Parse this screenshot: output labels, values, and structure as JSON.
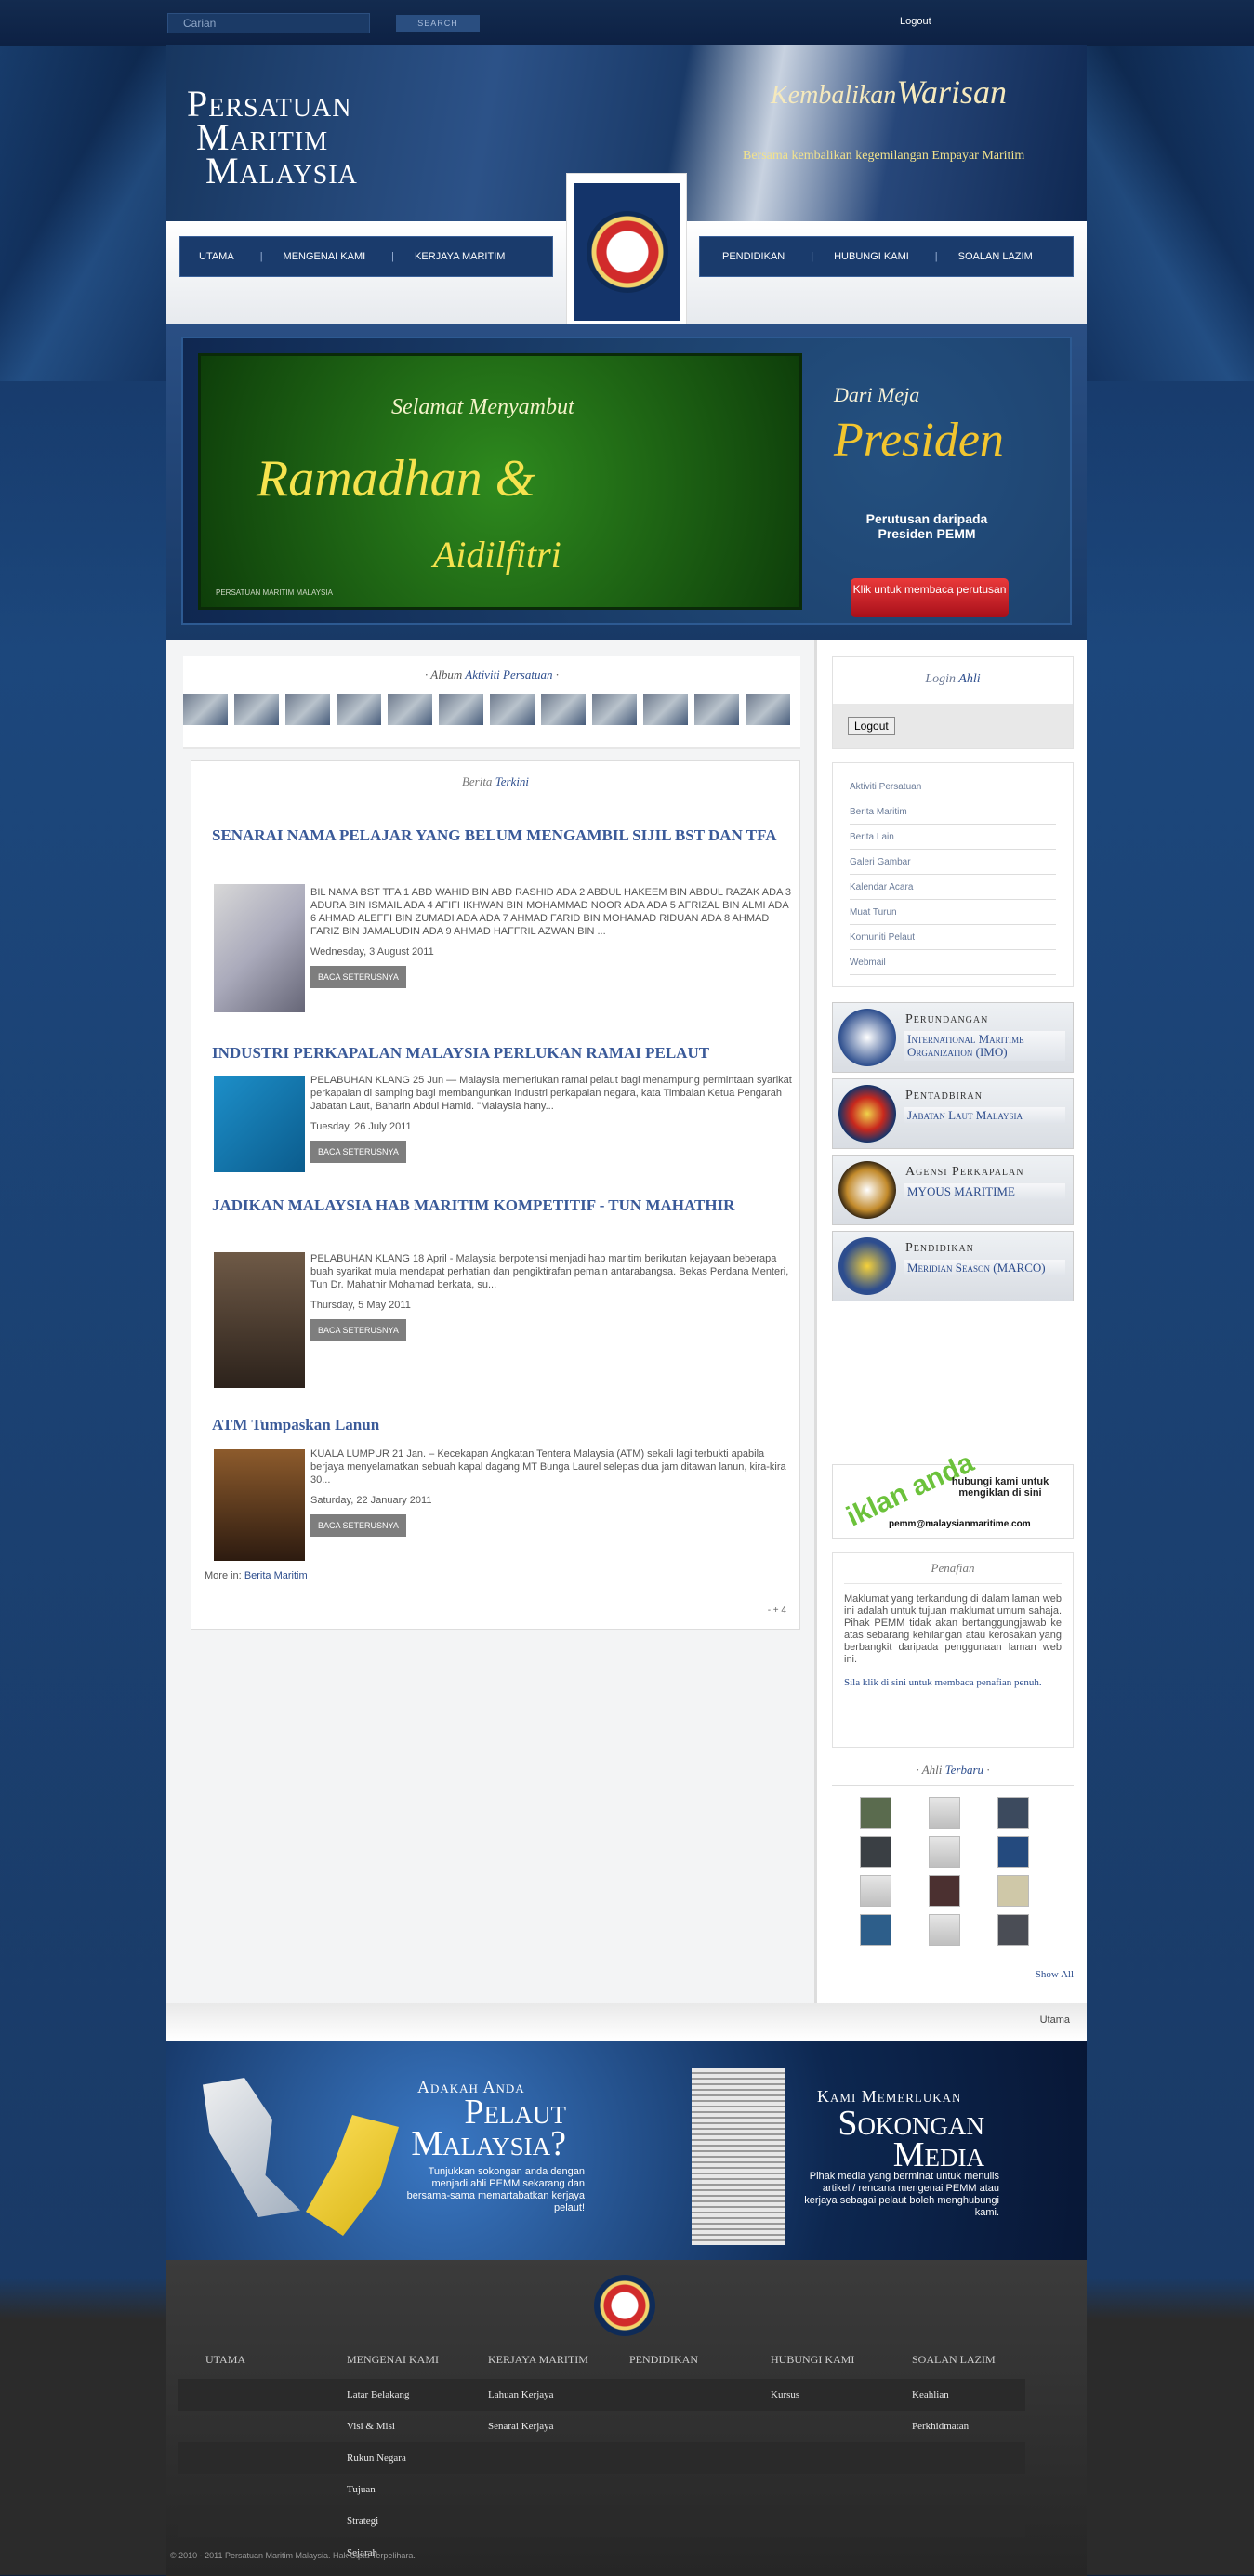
{
  "topbar": {
    "search_placeholder": "Carian",
    "search_button": "SEARCH",
    "logout": "Logout"
  },
  "header": {
    "title_lines": [
      "Persatuan",
      "Maritim",
      "Malaysia"
    ],
    "slogan_a": "Kembalikan",
    "slogan_b": "Warisan",
    "subslogan": "Bersama kembalikan kegemilangan Empayar Maritim"
  },
  "nav": {
    "left": [
      "UTAMA",
      "MENGENAI KAMI",
      "KERJAYA MARITIM"
    ],
    "right": [
      "PENDIDIKAN",
      "HUBUNGI KAMI",
      "SOALAN LAZIM"
    ]
  },
  "banner": {
    "selamat": "Selamat Menyambut",
    "ramadhan": "Ramadhan &",
    "aidil": "Aidilfitri",
    "org": "PERSATUAN MARITIM MALAYSIA",
    "dari": "Dari Meja",
    "presiden": "Presiden",
    "perutusan": "Perutusan daripada Presiden PEMM",
    "button": "Klik untuk membaca perutusan"
  },
  "album": {
    "prefix": "Album",
    "title": "Aktiviti Persatuan"
  },
  "news": {
    "heading_a": "Berita",
    "heading_b": "Terkini",
    "items": [
      {
        "title": "SENARAI NAMA PELAJAR YANG BELUM MENGAMBIL SIJIL BST DAN TFA",
        "body": "BIL NAMA BST TFA 1 ABD WAHID BIN ABD RASHID   ADA 2 ABDUL HAKEEM BIN ABDUL RAZAK ADA   3 ADURA BIN ISMAIL ADA   4 AFIFI IKHWAN BIN MOHAMMAD NOOR ADA ADA 5 AFRIZAL BIN ALMI   ADA 6 AHMAD ALEFFI BIN ZUMADI ADA ADA 7 AHMAD FARID BIN MOHAMAD RIDUAN   ADA 8 AHMAD FARIZ BIN JAMALUDIN   ADA 9 AHMAD HAFFRIL AZWAN BIN ...",
        "date": "Wednesday, 3 August 2011",
        "more": "BACA SETERUSNYA"
      },
      {
        "title": "INDUSTRI PERKAPALAN MALAYSIA PERLUKAN RAMAI PELAUT",
        "body": "PELABUHAN KLANG 25 Jun — Malaysia memerlukan ramai pelaut bagi menampung permintaan syarikat perkapalan di samping bagi membangunkan industri perkapalan negara, kata Timbalan Ketua Pengarah Jabatan Laut, Baharin Abdul Hamid. \"Malaysia hany...",
        "date": "Tuesday, 26 July 2011",
        "more": "BACA SETERUSNYA"
      },
      {
        "title": "JADIKAN MALAYSIA HAB MARITIM KOMPETITIF - TUN MAHATHIR",
        "body": "PELABUHAN KLANG 18 April - Malaysia berpotensi menjadi hab maritim berikutan kejayaan beberapa buah syarikat mula mendapat perhatian dan pengiktirafan pemain antarabangsa. Bekas Perdana Menteri, Tun Dr. Mahathir Mohamad berkata, su...",
        "date": "Thursday, 5 May 2011",
        "more": "BACA SETERUSNYA"
      },
      {
        "title": "ATM Tumpaskan Lanun",
        "body": "KUALA LUMPUR 21 Jan. – Kecekapan Angkatan Tentera Malaysia (ATM) sekali lagi terbukti apabila berjaya menyelamatkan sebuah kapal dagang MT Bunga Laurel selepas dua jam ditawan lanun, kira-kira 30...",
        "date": "Saturday, 22 January 2011",
        "more": "BACA SETERUSNYA"
      }
    ],
    "more_in": "More in:",
    "more_in_link": "Berita Maritim",
    "pager": "-  +  4"
  },
  "sidebar": {
    "login_a": "Login",
    "login_b": "Ahli",
    "logout_button": "Logout",
    "menu": [
      "Aktiviti Persatuan",
      "Berita Maritim",
      "Berita Lain",
      "Galeri Gambar",
      "Kalendar Acara",
      "Muat Turun",
      "Komuniti Pelaut",
      "Webmail"
    ],
    "links": [
      {
        "cat": "Perundangan",
        "name": "International Maritime Organization (IMO)"
      },
      {
        "cat": "Pentadbiran",
        "name": "Jabatan Laut Malaysia"
      },
      {
        "cat": "Agensi Perkapalan",
        "name": "MYOUS MARITIME"
      },
      {
        "cat": "Pendidikan",
        "name": "Meridian Season (MARCO)"
      }
    ],
    "iklan_logo": "iklan anda",
    "iklan_text": "hubungi kami untuk mengiklan di sini",
    "iklan_email": "pemm@malaysianmaritime.com",
    "penafian_title": "Penafian",
    "penafian_body": "Maklumat yang terkandung di dalam laman web ini adalah untuk tujuan maklumat umum sahaja. Pihak PEMM tidak akan bertanggungjawab ke atas sebarang kehilangan atau kerosakan yang berbangkit daripada penggunaan laman web ini.",
    "penafian_link": "Sila klik di sini untuk membaca penafian penuh.",
    "ahli_a": "Ahli",
    "ahli_b": "Terbaru",
    "show_all": "Show All"
  },
  "breadcrumb": "Utama",
  "promo": {
    "ada": "Adakah Anda",
    "pelaut": "Pelaut Malaysia?",
    "pelaut_text": "Tunjukkan sokongan anda dengan menjadi ahli PEMM sekarang dan bersama-sama memartabatkan kerjaya pelaut!",
    "kami": "Kami Memerlukan",
    "sokongan": "Sokongan Media",
    "sokongan_text": "Pihak media yang berminat untuk menulis artikel / rencana mengenai PEMM atau kerjaya sebagai pelaut boleh menghubungi kami."
  },
  "footer": {
    "cols": [
      {
        "head": "UTAMA",
        "items": []
      },
      {
        "head": "MENGENAI KAMI",
        "items": [
          "Latar Belakang",
          "Visi & Misi",
          "Rukun Negara",
          "Tujuan",
          "Strategi",
          "Sejarah"
        ]
      },
      {
        "head": "KERJAYA MARITIM",
        "items": [
          "Lahuan Kerjaya",
          "Senarai Kerjaya"
        ]
      },
      {
        "head": "PENDIDIKAN",
        "items": []
      },
      {
        "head": "HUBUNGI KAMI",
        "items": [
          "Kursus"
        ]
      },
      {
        "head": "SOALAN LAZIM",
        "items": [
          "Keahlian",
          "Perkhidmatan"
        ]
      }
    ],
    "copyright": "© 2010 - 2011 Persatuan Maritim Malaysia. Hak Cipta Terpelihara."
  }
}
